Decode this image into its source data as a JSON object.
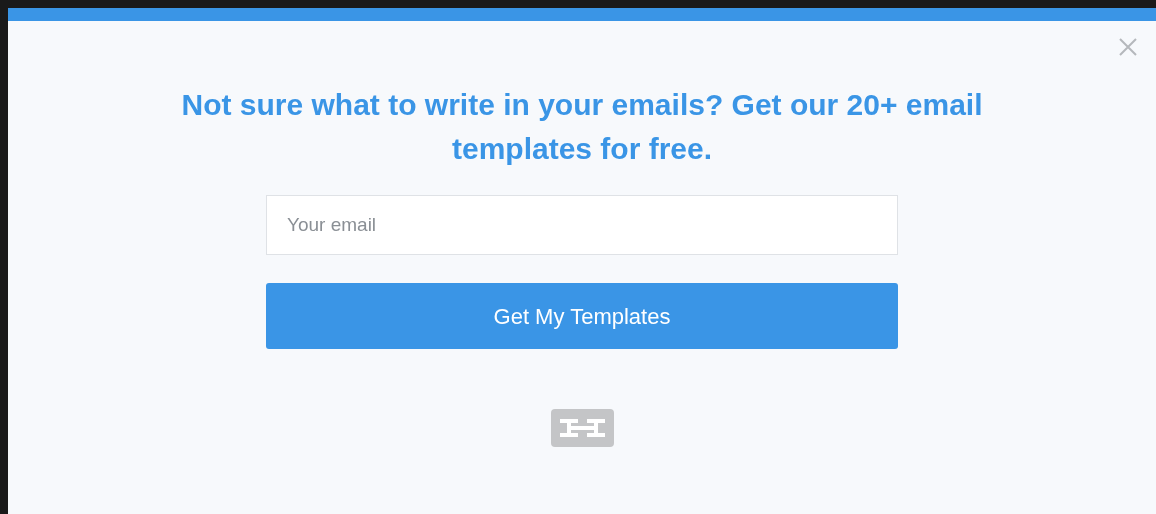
{
  "heading": "Not sure what to write in your emails? Get our 20+ email templates for free.",
  "email_field": {
    "placeholder": "Your email"
  },
  "submit_button": {
    "label": "Get My Templates"
  }
}
